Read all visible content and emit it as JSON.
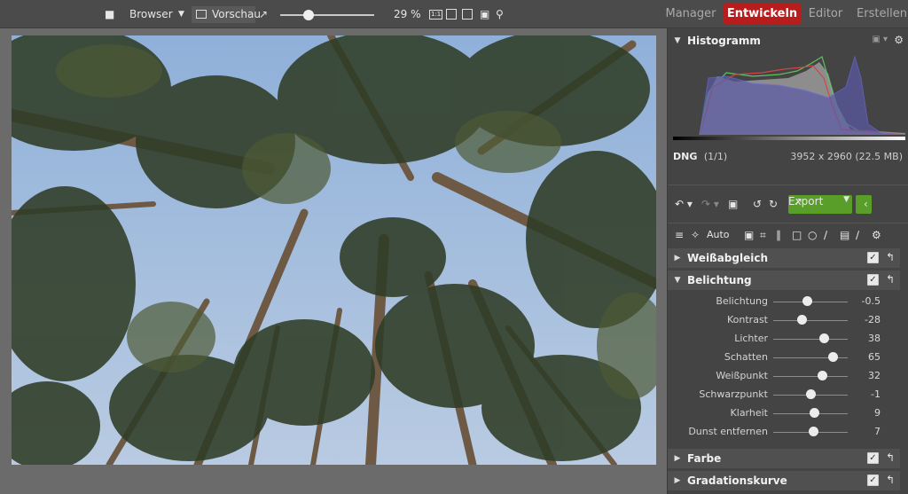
{
  "toolbar": {
    "browser_label": "Browser",
    "preview_label": "Vorschau",
    "zoom_value": "29 %",
    "zoom_fraction": 0.3
  },
  "modes": [
    {
      "label": "Manager",
      "active": false
    },
    {
      "label": "Entwickeln",
      "active": true
    },
    {
      "label": "Editor",
      "active": false
    },
    {
      "label": "Erstellen",
      "active": false
    }
  ],
  "histogram": {
    "title": "Histogramm",
    "format": "DNG",
    "count": "(1/1)",
    "dimensions": "3952 x 2960 (22.5 MB)"
  },
  "actions": {
    "export_label": "Export",
    "auto_label": "Auto"
  },
  "sections": {
    "weissabgleich": "Weißabgleich",
    "belichtung": "Belichtung",
    "farbe": "Farbe",
    "gradationskurve": "Gradationskurve"
  },
  "sliders": [
    {
      "label": "Belichtung",
      "value": "-0.5",
      "fraction": 0.45
    },
    {
      "label": "Kontrast",
      "value": "-28",
      "fraction": 0.38
    },
    {
      "label": "Lichter",
      "value": "38",
      "fraction": 0.68
    },
    {
      "label": "Schatten",
      "value": "65",
      "fraction": 0.8
    },
    {
      "label": "Weißpunkt",
      "value": "32",
      "fraction": 0.65
    },
    {
      "label": "Schwarzpunkt",
      "value": "-1",
      "fraction": 0.5
    },
    {
      "label": "Klarheit",
      "value": "9",
      "fraction": 0.55
    },
    {
      "label": "Dunst entfernen",
      "value": "7",
      "fraction": 0.54
    }
  ],
  "colors": {
    "accent_red": "#b81d1d",
    "export_green": "#5a9e2a"
  }
}
